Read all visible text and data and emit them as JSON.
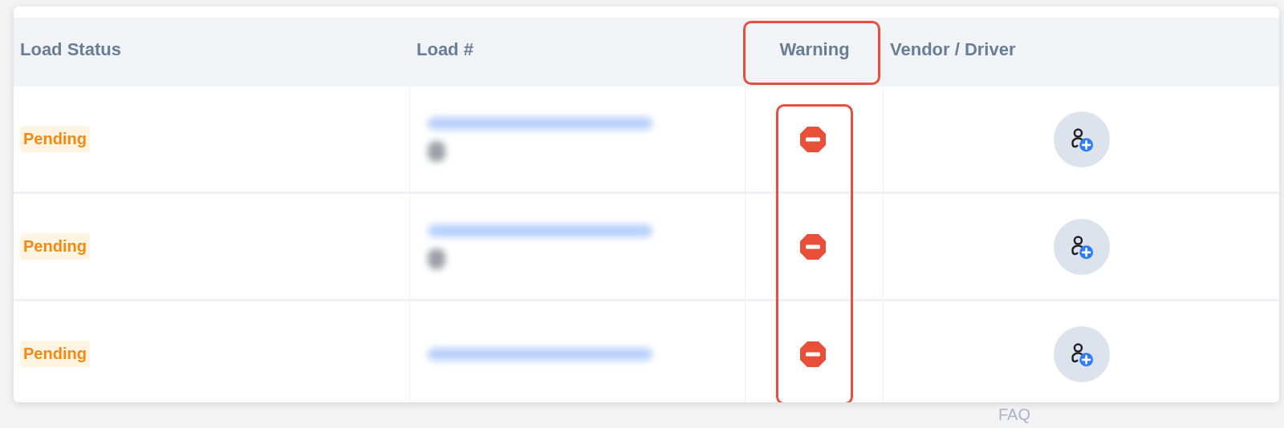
{
  "table": {
    "columns": [
      {
        "label": "Load Status",
        "highlighted": false
      },
      {
        "label": "Load #",
        "highlighted": false
      },
      {
        "label": "Warning",
        "highlighted": true
      },
      {
        "label": "Vendor / Driver",
        "highlighted": false
      }
    ],
    "rows": [
      {
        "status": "Pending",
        "load_redacted": true,
        "sub_redacted": true,
        "warning": true
      },
      {
        "status": "Pending",
        "load_redacted": true,
        "sub_redacted": true,
        "warning": true
      },
      {
        "status": "Pending",
        "load_redacted": true,
        "sub_redacted": false,
        "warning": true
      }
    ],
    "warning_column_highlighted": true
  },
  "background": {
    "link": "FAQ"
  }
}
